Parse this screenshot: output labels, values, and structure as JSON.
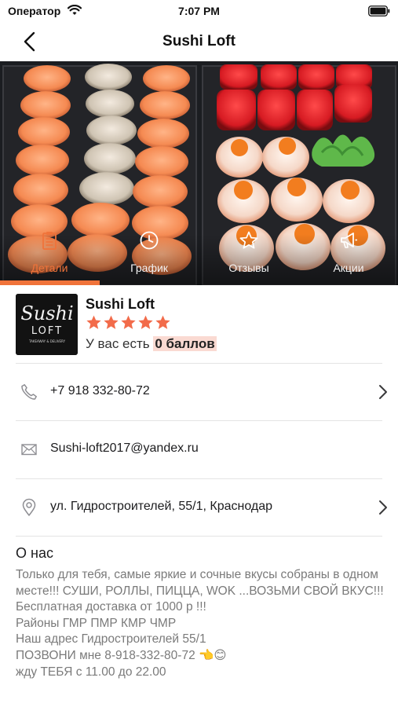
{
  "status_bar": {
    "carrier": "Оператор",
    "time": "7:07 PM"
  },
  "nav": {
    "title": "Sushi Loft"
  },
  "tabs": [
    {
      "label": "Детали",
      "icon": "clipboard-icon",
      "active": true
    },
    {
      "label": "График",
      "icon": "clock-icon",
      "active": false
    },
    {
      "label": "Отзывы",
      "icon": "star-outline-icon",
      "active": false
    },
    {
      "label": "Акции",
      "icon": "megaphone-icon",
      "active": false
    }
  ],
  "profile": {
    "name": "Sushi Loft",
    "rating": 5,
    "points_prefix": "У вас есть",
    "points_value": "0 баллов",
    "logo_text_top": "Sushi",
    "logo_text_mid": "LOFT",
    "logo_text_bottom": "TAKEAWAY & DELIVERY"
  },
  "contacts": {
    "phone": "+7 918 332-80-72",
    "email": "Sushi-loft2017@yandex.ru",
    "address": "ул. Гидростроителей, 55/1, Краснодар"
  },
  "about": {
    "title": "О нас",
    "text": "Только для тебя, самые яркие и сочные вкусы собраны в одном месте!!! СУШИ, РОЛЛЫ, ПИЦЦА, WOK ...ВОЗЬМИ СВОЙ ВКУС!!!\nБесплатная доставка от 1000 р !!!\nРайоны ГМР ПМР КМР ЧМР\nНаш адрес Гидростроителей 55/1\nПОЗВОНИ мне 8-918-332-80-72 👈😊\nжду ТЕБЯ с 11.00 до 22.00"
  },
  "colors": {
    "accent": "#f0733a",
    "star": "#f26b4a",
    "highlight": "#fadad2"
  }
}
